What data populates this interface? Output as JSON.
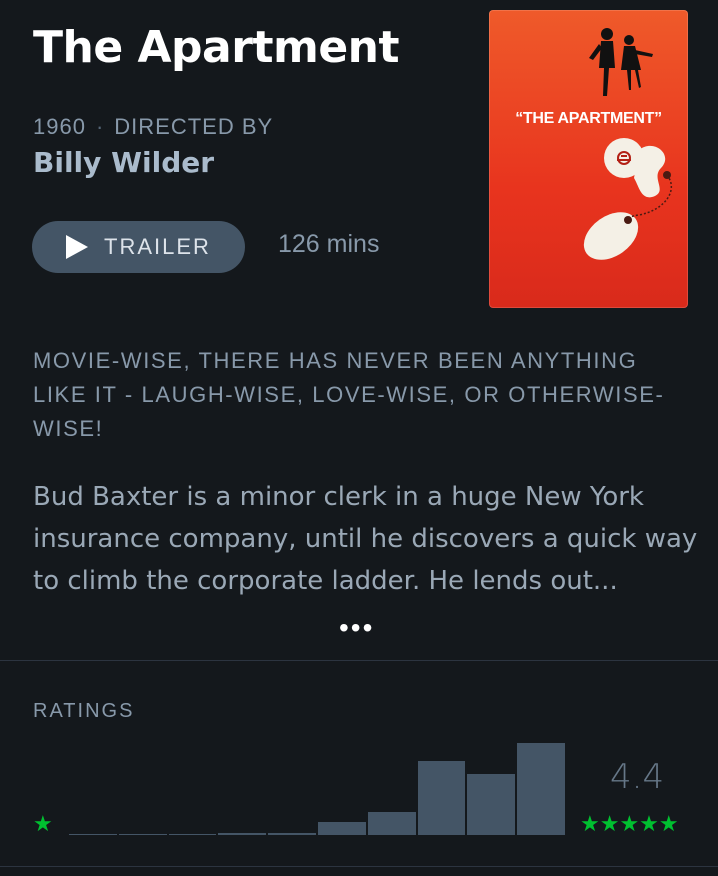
{
  "film": {
    "title": "The Apartment",
    "year": "1960",
    "directed_by_label": "DIRECTED BY",
    "director": "Billy Wilder",
    "trailer_label": "TRAILER",
    "runtime": "126 mins",
    "poster_text": "“THE APARTMENT”",
    "tagline": "MOVIE-WISE, THERE HAS NEVER BEEN ANYTHING LIKE IT - LAUGH-WISE, LOVE-WISE, OR OTHERWISE-WISE!",
    "synopsis": "Bud Baxter is a minor clerk in a huge New York insurance company, until he discovers a quick way to climb the corporate ladder. He lends out...",
    "more_label": "•••"
  },
  "ratings": {
    "label": "RATINGS",
    "average": "4.4",
    "low_star": "★",
    "high_stars": "★★★★★",
    "histogram_fraction": [
      0.01,
      0.01,
      0.01,
      0.02,
      0.02,
      0.11,
      0.2,
      0.64,
      0.53,
      0.8
    ]
  },
  "colors": {
    "background": "#14181c",
    "accent_green": "#00c030",
    "bar": "#445566"
  }
}
